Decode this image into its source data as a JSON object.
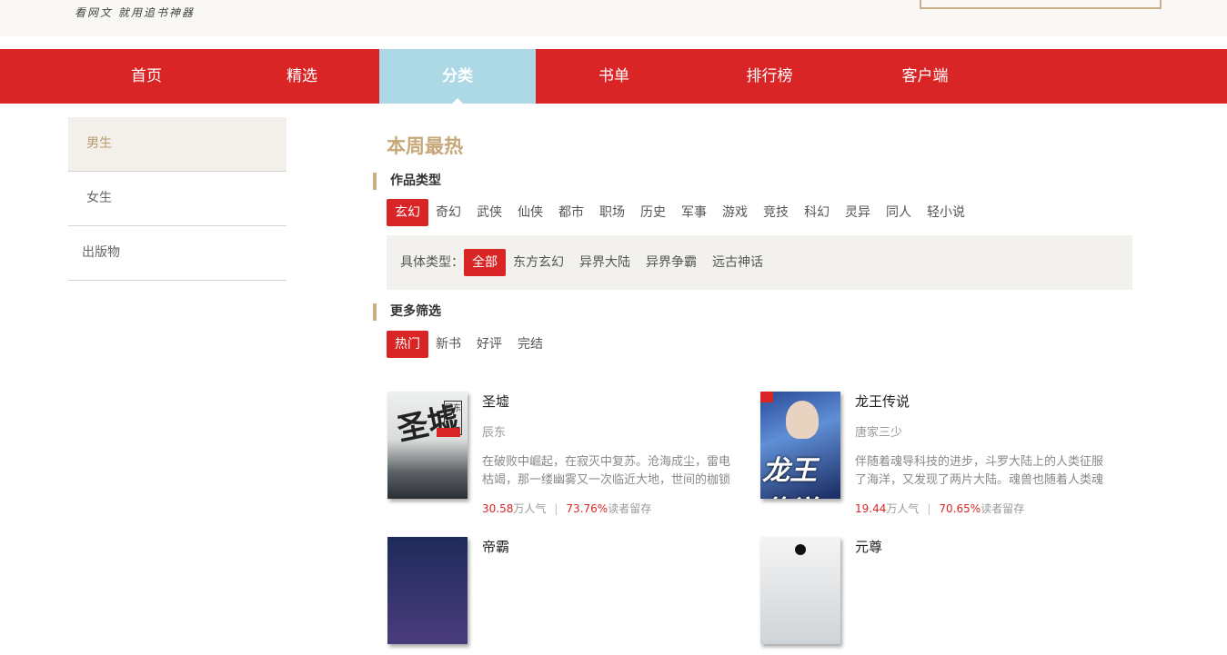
{
  "header": {
    "slogan": "看网文  就用追书神器"
  },
  "nav": {
    "items": [
      {
        "label": "首页"
      },
      {
        "label": "精选"
      },
      {
        "label": "分类",
        "active": true
      },
      {
        "label": "书单"
      },
      {
        "label": "排行榜"
      },
      {
        "label": "客户端"
      }
    ]
  },
  "sidebar": {
    "items": [
      {
        "label": "男生",
        "active": true
      },
      {
        "label": "女生"
      },
      {
        "label": "出版物"
      }
    ]
  },
  "main": {
    "title": "本周最热",
    "genre_section": {
      "label": "作品类型",
      "tags": [
        "玄幻",
        "奇幻",
        "武侠",
        "仙侠",
        "都市",
        "职场",
        "历史",
        "军事",
        "游戏",
        "竞技",
        "科幻",
        "灵异",
        "同人",
        "轻小说"
      ],
      "selected": "玄幻"
    },
    "subtype_section": {
      "label": "具体类型：",
      "tags": [
        "全部",
        "东方玄幻",
        "异界大陆",
        "异界争霸",
        "远古神话"
      ],
      "selected": "全部"
    },
    "filter_section": {
      "label": "更多筛选",
      "tags": [
        "热门",
        "新书",
        "好评",
        "完结"
      ],
      "selected": "热门"
    },
    "books": [
      {
        "title": "圣墟",
        "author": "辰东",
        "description": "在破败中崛起，在寂灭中复苏。沧海成尘，雷电枯竭，那一缕幽雾又一次临近大地，世间的枷锁被打...",
        "readers_num": "30.58",
        "readers_unit": "万人气",
        "retention_num": "73.76%",
        "retention_unit": "读者留存",
        "cover_text": "圣墟",
        "cover_stamp": "辰东"
      },
      {
        "title": "龙王传说",
        "author": "唐家三少",
        "description": "伴随着魂导科技的进步，斗罗大陆上的人类征服了海洋，又发现了两片大陆。魂兽也随着人类魂师的...",
        "readers_num": "19.44",
        "readers_unit": "万人气",
        "retention_num": "70.65%",
        "retention_unit": "读者留存",
        "cover_text": "龙王传说"
      },
      {
        "title": "帝霸"
      },
      {
        "title": "元尊"
      }
    ]
  }
}
